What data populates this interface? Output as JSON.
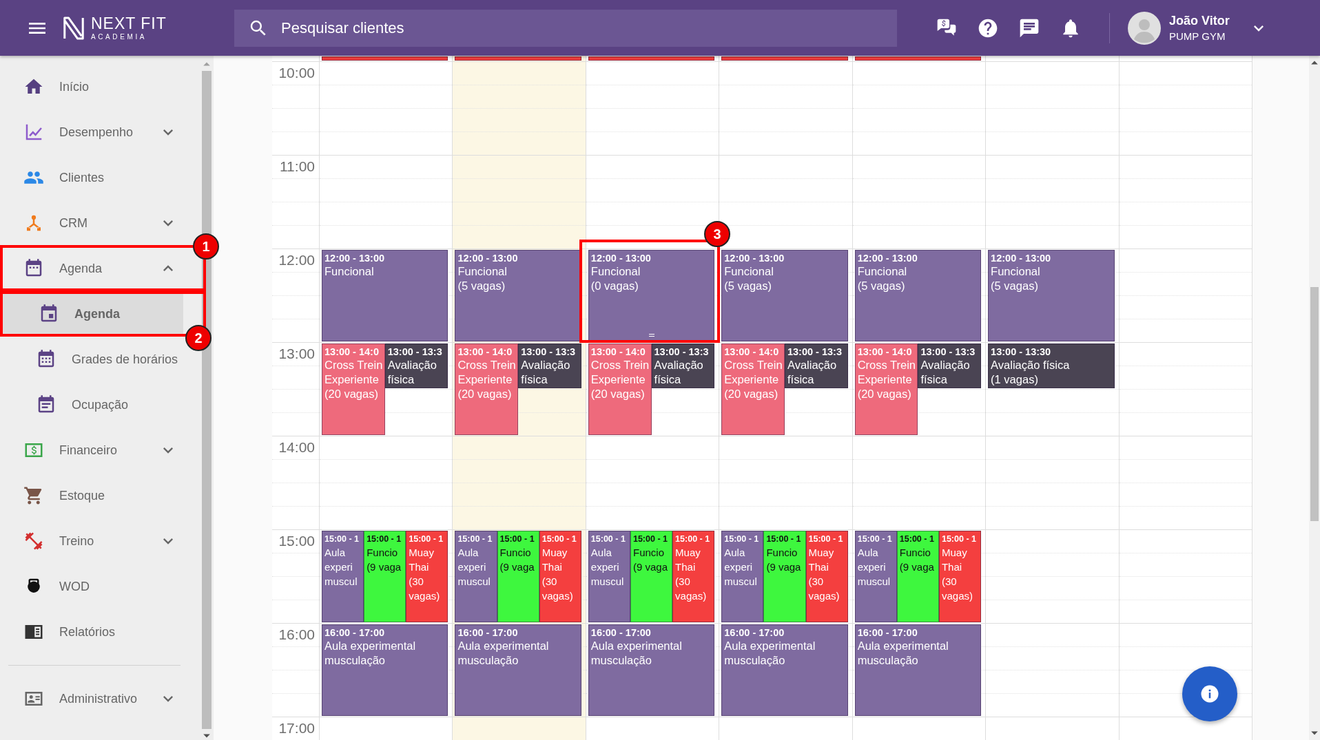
{
  "header": {
    "logo": {
      "name": "NEXT FIT",
      "tagline": "ACADEMIA"
    },
    "search": {
      "placeholder": "Pesquisar clientes"
    },
    "user": {
      "name": "João Vitor",
      "company": "PUMP GYM"
    }
  },
  "sidebar": {
    "items": [
      {
        "label": "Início",
        "kind": "link",
        "selected": false
      },
      {
        "label": "Desempenho",
        "kind": "group",
        "expanded": false,
        "selected": false
      },
      {
        "label": "Clientes",
        "kind": "link",
        "selected": false
      },
      {
        "label": "CRM",
        "kind": "group",
        "expanded": false,
        "selected": false
      },
      {
        "label": "Agenda",
        "kind": "group",
        "expanded": true,
        "selected": false,
        "children": [
          {
            "label": "Agenda",
            "selected": true
          },
          {
            "label": "Grades de horários",
            "selected": false
          },
          {
            "label": "Ocupação",
            "selected": false
          }
        ]
      },
      {
        "label": "Financeiro",
        "kind": "group",
        "expanded": false,
        "selected": false
      },
      {
        "label": "Estoque",
        "kind": "link",
        "selected": false
      },
      {
        "label": "Treino",
        "kind": "group",
        "expanded": false,
        "selected": false
      },
      {
        "label": "WOD",
        "kind": "link",
        "selected": false
      },
      {
        "label": "Relatórios",
        "kind": "link",
        "selected": false
      }
    ],
    "footer_items": [
      {
        "label": "Administrativo",
        "kind": "group",
        "expanded": false,
        "selected": false
      }
    ]
  },
  "calendar": {
    "rows": [
      {
        "cells": [
          {
            "today": false,
            "events": [
              {
                "kind": "strip",
                "color": "#f43f3f",
                "hovered": false
              }
            ]
          },
          {
            "today": true,
            "events": [
              {
                "kind": "strip",
                "color": "#f43f3f",
                "hovered": false
              }
            ]
          },
          {
            "today": false,
            "events": [
              {
                "kind": "strip",
                "color": "#f43f3f",
                "hovered": false
              }
            ]
          },
          {
            "today": false,
            "events": [
              {
                "kind": "strip",
                "color": "#f43f3f",
                "hovered": false
              }
            ]
          },
          {
            "today": false,
            "events": [
              {
                "kind": "strip",
                "color": "#f43f3f",
                "hovered": false
              }
            ]
          },
          {
            "today": false
          },
          {
            "today": false
          }
        ]
      },
      {
        "hour": "10:00",
        "cells": [
          {
            "today": false
          },
          {
            "today": true
          },
          {
            "today": false
          },
          {
            "today": false
          },
          {
            "today": false
          },
          {
            "today": false
          },
          {
            "today": false
          }
        ]
      },
      {
        "hour": "11:00",
        "cells": [
          {
            "today": false
          },
          {
            "today": true
          },
          {
            "today": false
          },
          {
            "today": false
          },
          {
            "today": false
          },
          {
            "today": false
          },
          {
            "today": false
          }
        ]
      },
      {
        "hour": "12:00",
        "cells": [
          {
            "today": false,
            "events": [
              {
                "kind": "hour",
                "time": "12:00 - 13:00",
                "lines": [
                  "Funcional"
                ],
                "color": "#7f6ba0",
                "hovered": false
              }
            ]
          },
          {
            "today": true,
            "events": [
              {
                "kind": "hour",
                "time": "12:00 - 13:00",
                "lines": [
                  "Funcional",
                  "(5 vagas)"
                ],
                "color": "#7f6ba0",
                "hovered": false
              }
            ]
          },
          {
            "today": false,
            "events": [
              {
                "kind": "hour",
                "time": "12:00 - 13:00",
                "lines": [
                  "Funcional",
                  "(0 vagas)"
                ],
                "color": "#7f6ba0",
                "hovered": true
              }
            ]
          },
          {
            "today": false,
            "events": [
              {
                "kind": "hour",
                "time": "12:00 - 13:00",
                "lines": [
                  "Funcional",
                  "(5 vagas)"
                ],
                "color": "#7f6ba0",
                "hovered": false
              }
            ]
          },
          {
            "today": false,
            "events": [
              {
                "kind": "hour",
                "time": "12:00 - 13:00",
                "lines": [
                  "Funcional",
                  "(5 vagas)"
                ],
                "color": "#7f6ba0",
                "hovered": false
              }
            ]
          },
          {
            "today": false,
            "events": [
              {
                "kind": "hour",
                "time": "12:00 - 13:00",
                "lines": [
                  "Funcional",
                  "(5 vagas)"
                ],
                "color": "#7f6ba0",
                "hovered": false
              }
            ]
          },
          {
            "today": false
          }
        ]
      },
      {
        "hour": "13:00",
        "cells": [
          {
            "today": false,
            "events": [
              {
                "kind": "hour",
                "time": "13:00 - 14:0",
                "lines": [
                  "Cross Trein",
                  "Experiente",
                  "(20 vagas)"
                ],
                "color": "#ee6a7c",
                "hovered": false
              },
              {
                "kind": "half_hour",
                "time": "13:00 - 13:3",
                "lines": [
                  "Avaliação",
                  "física"
                ],
                "color": "#4a4453",
                "hovered": false
              }
            ]
          },
          {
            "today": true,
            "events": [
              {
                "kind": "hour",
                "time": "13:00 - 14:0",
                "lines": [
                  "Cross Trein",
                  "Experiente",
                  "(20 vagas)"
                ],
                "color": "#ee6a7c",
                "hovered": false
              },
              {
                "kind": "half_hour",
                "time": "13:00 - 13:3",
                "lines": [
                  "Avaliação",
                  "física"
                ],
                "color": "#4a4453",
                "hovered": false
              }
            ]
          },
          {
            "today": false,
            "events": [
              {
                "kind": "hour",
                "time": "13:00 - 14:0",
                "lines": [
                  "Cross Trein",
                  "Experiente",
                  "(20 vagas)"
                ],
                "color": "#ee6a7c",
                "hovered": false
              },
              {
                "kind": "half_hour",
                "time": "13:00 - 13:3",
                "lines": [
                  "Avaliação",
                  "física"
                ],
                "color": "#4a4453",
                "hovered": false
              }
            ]
          },
          {
            "today": false,
            "events": [
              {
                "kind": "hour",
                "time": "13:00 - 14:0",
                "lines": [
                  "Cross Trein",
                  "Experiente",
                  "(20 vagas)"
                ],
                "color": "#ee6a7c",
                "hovered": false
              },
              {
                "kind": "half_hour",
                "time": "13:00 - 13:3",
                "lines": [
                  "Avaliação",
                  "física"
                ],
                "color": "#4a4453",
                "hovered": false
              }
            ]
          },
          {
            "today": false,
            "events": [
              {
                "kind": "hour",
                "time": "13:00 - 14:0",
                "lines": [
                  "Cross Trein",
                  "Experiente",
                  "(20 vagas)"
                ],
                "color": "#ee6a7c",
                "hovered": false
              },
              {
                "kind": "half_hour",
                "time": "13:00 - 13:3",
                "lines": [
                  "Avaliação",
                  "física"
                ],
                "color": "#4a4453",
                "hovered": false
              }
            ]
          },
          {
            "today": false,
            "events": [
              {
                "kind": "half_hour",
                "time": "13:00 - 13:30",
                "lines": [
                  "Avaliação física",
                  "(1 vagas)"
                ],
                "color": "#4a4453",
                "hovered": false
              }
            ]
          },
          {
            "today": false
          }
        ]
      },
      {
        "hour": "14:00",
        "cells": [
          {
            "today": false
          },
          {
            "today": true
          },
          {
            "today": false
          },
          {
            "today": false
          },
          {
            "today": false
          },
          {
            "today": false
          },
          {
            "today": false
          }
        ]
      },
      {
        "hour": "15:00",
        "cells": [
          {
            "today": false,
            "events": [
              {
                "kind": "hour",
                "time": "15:00 - 1",
                "lines": [
                  "Aula",
                  "experi",
                  "muscul"
                ],
                "color": "#7f6ba0",
                "hovered": false
              },
              {
                "kind": "hour",
                "time": "15:00 - 1",
                "lines": [
                  "Funcio",
                  "(9 vaga"
                ],
                "color": "#3ef73e",
                "hovered": false
              },
              {
                "kind": "hour",
                "time": "15:00 - 1",
                "lines": [
                  "Muay",
                  "Thai",
                  "(30",
                  "vagas)"
                ],
                "color": "#f43f3f",
                "hovered": false
              }
            ]
          },
          {
            "today": true,
            "events": [
              {
                "kind": "hour",
                "time": "15:00 - 1",
                "lines": [
                  "Aula",
                  "experi",
                  "muscul"
                ],
                "color": "#7f6ba0",
                "hovered": false
              },
              {
                "kind": "hour",
                "time": "15:00 - 1",
                "lines": [
                  "Funcio",
                  "(9 vaga"
                ],
                "color": "#3ef73e",
                "hovered": false
              },
              {
                "kind": "hour",
                "time": "15:00 - 1",
                "lines": [
                  "Muay",
                  "Thai",
                  "(30",
                  "vagas)"
                ],
                "color": "#f43f3f",
                "hovered": false
              }
            ]
          },
          {
            "today": false,
            "events": [
              {
                "kind": "hour",
                "time": "15:00 - 1",
                "lines": [
                  "Aula",
                  "experi",
                  "muscul"
                ],
                "color": "#7f6ba0",
                "hovered": false
              },
              {
                "kind": "hour",
                "time": "15:00 - 1",
                "lines": [
                  "Funcio",
                  "(9 vaga"
                ],
                "color": "#3ef73e",
                "hovered": false
              },
              {
                "kind": "hour",
                "time": "15:00 - 1",
                "lines": [
                  "Muay",
                  "Thai",
                  "(30",
                  "vagas)"
                ],
                "color": "#f43f3f",
                "hovered": false
              }
            ]
          },
          {
            "today": false,
            "events": [
              {
                "kind": "hour",
                "time": "15:00 - 1",
                "lines": [
                  "Aula",
                  "experi",
                  "muscul"
                ],
                "color": "#7f6ba0",
                "hovered": false
              },
              {
                "kind": "hour",
                "time": "15:00 - 1",
                "lines": [
                  "Funcio",
                  "(9 vaga"
                ],
                "color": "#3ef73e",
                "hovered": false
              },
              {
                "kind": "hour",
                "time": "15:00 - 1",
                "lines": [
                  "Muay",
                  "Thai",
                  "(30",
                  "vagas)"
                ],
                "color": "#f43f3f",
                "hovered": false
              }
            ]
          },
          {
            "today": false,
            "events": [
              {
                "kind": "hour",
                "time": "15:00 - 1",
                "lines": [
                  "Aula",
                  "experi",
                  "muscul"
                ],
                "color": "#7f6ba0",
                "hovered": false
              },
              {
                "kind": "hour",
                "time": "15:00 - 1",
                "lines": [
                  "Funcio",
                  "(9 vaga"
                ],
                "color": "#3ef73e",
                "hovered": false
              },
              {
                "kind": "hour",
                "time": "15:00 - 1",
                "lines": [
                  "Muay",
                  "Thai",
                  "(30",
                  "vagas)"
                ],
                "color": "#f43f3f",
                "hovered": false
              }
            ]
          },
          {
            "today": false
          },
          {
            "today": false
          }
        ]
      },
      {
        "hour": "16:00",
        "cells": [
          {
            "today": false,
            "events": [
              {
                "kind": "hour",
                "time": "16:00 - 17:00",
                "lines": [
                  "Aula experimental",
                  "musculação"
                ],
                "color": "#7f6ba0",
                "hovered": false
              }
            ]
          },
          {
            "today": true,
            "events": [
              {
                "kind": "hour",
                "time": "16:00 - 17:00",
                "lines": [
                  "Aula experimental",
                  "musculação"
                ],
                "color": "#7f6ba0",
                "hovered": false
              }
            ]
          },
          {
            "today": false,
            "events": [
              {
                "kind": "hour",
                "time": "16:00 - 17:00",
                "lines": [
                  "Aula experimental",
                  "musculação"
                ],
                "color": "#7f6ba0",
                "hovered": false
              }
            ]
          },
          {
            "today": false,
            "events": [
              {
                "kind": "hour",
                "time": "16:00 - 17:00",
                "lines": [
                  "Aula experimental",
                  "musculação"
                ],
                "color": "#7f6ba0",
                "hovered": false
              }
            ]
          },
          {
            "today": false,
            "events": [
              {
                "kind": "hour",
                "time": "16:00 - 17:00",
                "lines": [
                  "Aula experimental",
                  "musculação"
                ],
                "color": "#7f6ba0",
                "hovered": false
              }
            ]
          },
          {
            "today": false
          },
          {
            "today": false
          }
        ]
      },
      {
        "hour": "17:00",
        "cells": [
          {
            "today": false
          },
          {
            "today": true
          },
          {
            "today": false
          },
          {
            "today": false
          },
          {
            "today": false
          },
          {
            "today": false
          },
          {
            "today": false
          }
        ]
      }
    ]
  },
  "annotations": [
    {
      "number": "1"
    },
    {
      "number": "2"
    },
    {
      "number": "3"
    }
  ]
}
